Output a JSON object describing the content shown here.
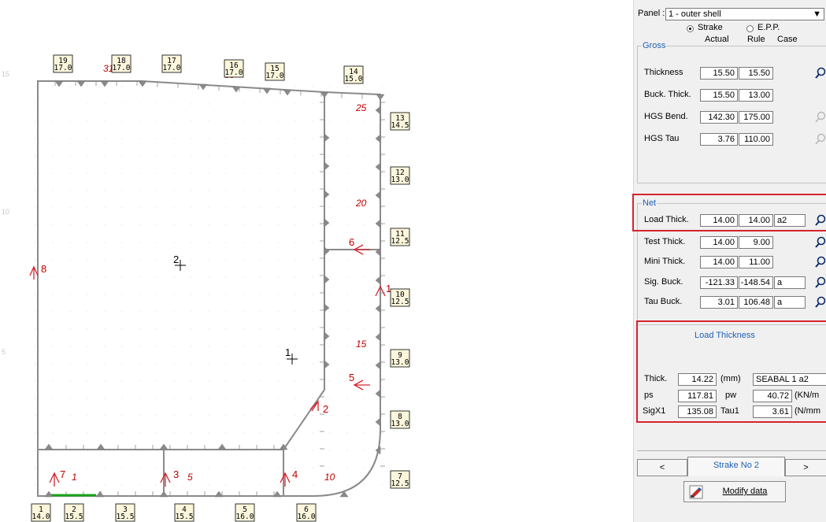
{
  "drawing": {
    "top_boxes": [
      {
        "id": "19",
        "val": "17.0"
      },
      {
        "id": "18",
        "val": "17.0"
      },
      {
        "id": "17",
        "val": "17.0"
      },
      {
        "id": "16",
        "val": "17.0"
      },
      {
        "id": "15",
        "val": "17.0"
      },
      {
        "id": "14",
        "val": "15.0"
      }
    ],
    "right_boxes": [
      {
        "id": "13",
        "val": "14.5"
      },
      {
        "id": "12",
        "val": "13.0"
      },
      {
        "id": "11",
        "val": "12.5"
      },
      {
        "id": "10",
        "val": "12.5"
      },
      {
        "id": "9",
        "val": "13.0"
      },
      {
        "id": "8",
        "val": "13.0"
      },
      {
        "id": "7",
        "val": "12.5"
      }
    ],
    "bottom_boxes": [
      {
        "id": "1",
        "val": "14.0"
      },
      {
        "id": "2",
        "val": "15.5"
      },
      {
        "id": "3",
        "val": "15.5"
      },
      {
        "id": "4",
        "val": "15.5"
      },
      {
        "id": "5",
        "val": "16.0"
      },
      {
        "id": "6",
        "val": "16.0"
      }
    ],
    "red_numbers": [
      "30",
      "31",
      "25",
      "20",
      "15",
      "10",
      "5",
      "1"
    ],
    "plate_labels": [
      "8",
      "6",
      "5",
      "1",
      "2",
      "3",
      "4",
      "7"
    ],
    "node_labels": [
      "2",
      "1"
    ],
    "axis_marks": [
      "15",
      "10",
      "5"
    ]
  },
  "panel": {
    "panel_label": "Panel :",
    "panel_value": "1 - outer shell",
    "radio_strake": "Strake",
    "radio_epp": "E.P.P.",
    "col_actual": "Actual",
    "col_rule": "Rule",
    "col_case": "Case",
    "gross": {
      "title": "Gross",
      "rows": [
        {
          "label": "Thickness",
          "actual": "15.50",
          "rule": "15.50"
        },
        {
          "label": "Buck. Thick.",
          "actual": "15.50",
          "rule": "13.00"
        },
        {
          "label": "HGS Bend.",
          "actual": "142.30",
          "rule": "175.00"
        },
        {
          "label": "HGS Tau",
          "actual": "3.76",
          "rule": "110.00"
        }
      ]
    },
    "net": {
      "title": "Net",
      "rows": [
        {
          "label": "Load Thick.",
          "actual": "14.00",
          "rule": "14.00",
          "case": "a2"
        },
        {
          "label": "Test Thick.",
          "actual": "14.00",
          "rule": "9.00",
          "case": ""
        },
        {
          "label": "Mini Thick.",
          "actual": "14.00",
          "rule": "11.00",
          "case": ""
        },
        {
          "label": "Sig. Buck.",
          "actual": "-121.33",
          "rule": "-148.54",
          "case": "a"
        },
        {
          "label": "Tau Buck.",
          "actual": "3.01",
          "rule": "106.48",
          "case": "a"
        }
      ]
    },
    "load": {
      "title": "Load Thickness",
      "thick_label": "Thick.",
      "thick_value": "14.22",
      "thick_unit": "(mm)",
      "case_value": "SEABAL 1 a2",
      "ps_label": "ps",
      "ps_value": "117.81",
      "pw_label": "pw",
      "pw_value": "40.72",
      "pw_unit": "(KN/m",
      "sig_label": "SigX1",
      "sig_value": "135.08",
      "tau_label": "Tau1",
      "tau_value": "3.61",
      "tau_unit": "(N/mm"
    },
    "nav": {
      "prev": "<",
      "tab": "Strake No 2",
      "next": ">"
    },
    "modify": "Modify data",
    "accent_red": "#d6232e",
    "group_title_color": "#1f5fb4"
  }
}
